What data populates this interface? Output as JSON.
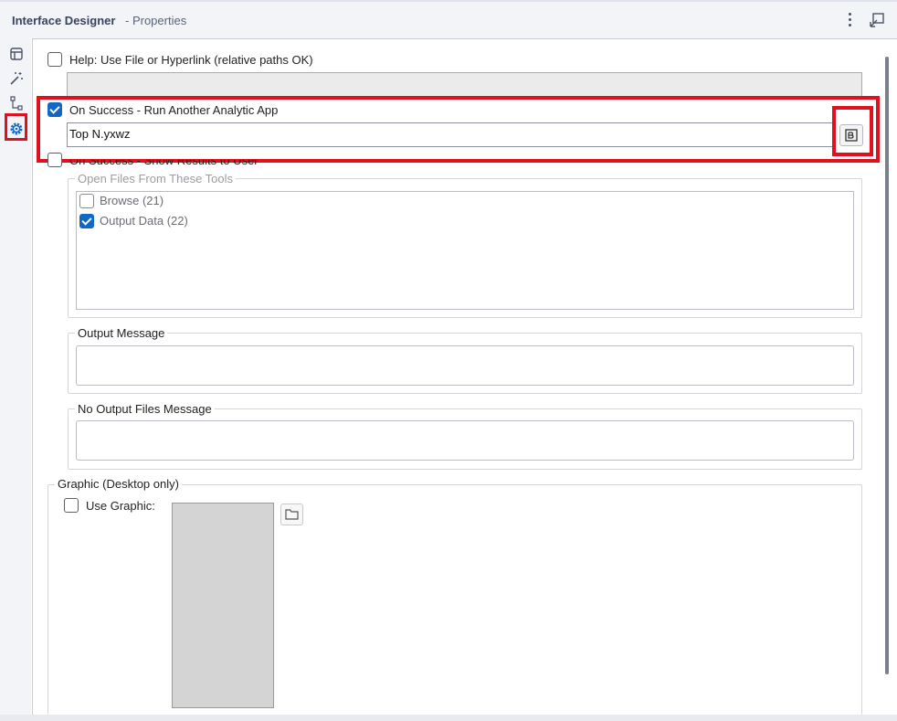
{
  "window": {
    "title": "Interface Designer",
    "subtitle": "- Properties",
    "more_icon": "kebab-menu-icon",
    "popout_icon": "popout-icon"
  },
  "sidebar": {
    "items": [
      {
        "name": "layout",
        "icon": "layout-icon"
      },
      {
        "name": "actions",
        "icon": "magic-wand-icon"
      },
      {
        "name": "tree",
        "icon": "tree-icon"
      },
      {
        "name": "properties",
        "icon": "gear-icon",
        "selected": true
      }
    ]
  },
  "help": {
    "label": "Help: Use File or Hyperlink (relative paths OK)",
    "checked": false,
    "value": ""
  },
  "run_app": {
    "label": "On Success - Run Another Analytic App",
    "checked": true,
    "value": "Top N.yxwz",
    "browse_icon": "browse-file-icon"
  },
  "show_results": {
    "label": "On Success - Show Results to User",
    "checked": false,
    "open_files_title": "Open Files From These Tools",
    "tools": [
      {
        "label": "Browse (21)",
        "checked": false
      },
      {
        "label": "Output Data (22)",
        "checked": true
      }
    ],
    "output_message_title": "Output Message",
    "output_message_value": "",
    "no_output_title": "No Output Files Message",
    "no_output_value": ""
  },
  "graphic": {
    "title": "Graphic (Desktop only)",
    "use_graphic_label": "Use Graphic:",
    "checked": false,
    "folder_icon": "folder-icon"
  },
  "colors": {
    "accent": "#1167c6",
    "highlight": "#e0101e",
    "titlebar_bg": "#f3f4f8"
  }
}
